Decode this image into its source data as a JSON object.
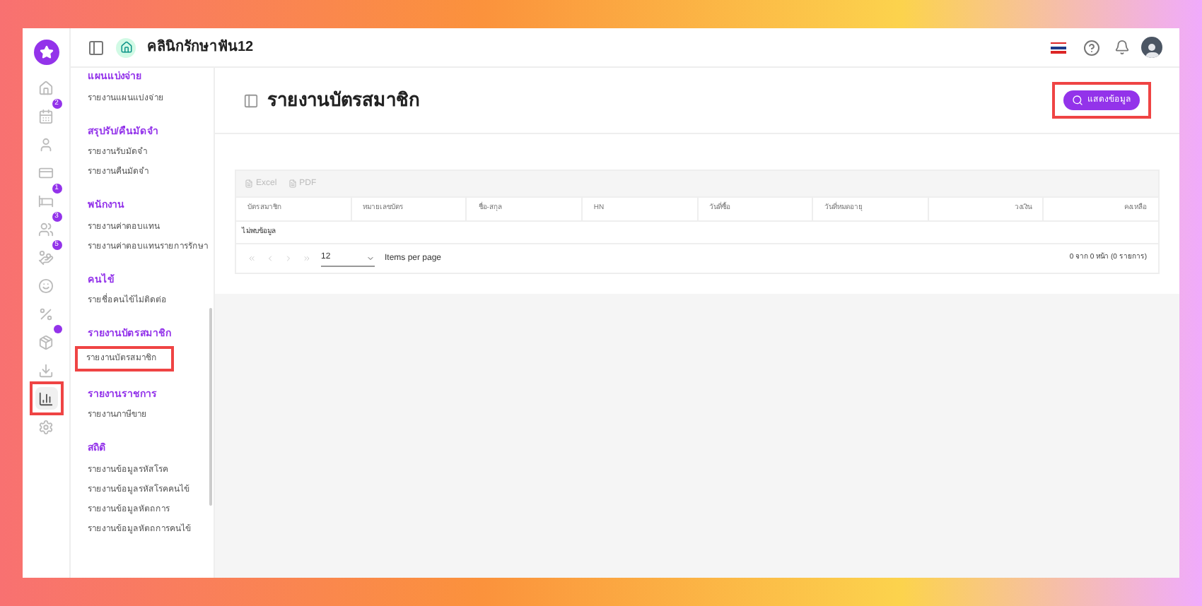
{
  "header": {
    "clinic_name": "คลินิกรักษาฟัน12"
  },
  "rail": [
    {
      "kind": "home",
      "selected": false
    },
    {
      "kind": "calendar",
      "selected": false,
      "badge": "2"
    },
    {
      "kind": "user",
      "selected": false
    },
    {
      "kind": "card",
      "selected": false
    },
    {
      "kind": "bed",
      "selected": false,
      "badge": "1"
    },
    {
      "kind": "people",
      "selected": false,
      "badge": "3"
    },
    {
      "kind": "hand",
      "selected": false,
      "badge": "5"
    },
    {
      "kind": "tooth",
      "selected": false
    },
    {
      "kind": "percent",
      "selected": false
    },
    {
      "kind": "box",
      "selected": false,
      "dot": true
    },
    {
      "kind": "download",
      "selected": false
    },
    {
      "kind": "chart",
      "selected": true
    },
    {
      "kind": "settings",
      "selected": false
    }
  ],
  "menu": [
    {
      "title": "แผนแบ่งจ่าย",
      "items": [
        {
          "label": "รายงานแผนแบ่งจ่าย",
          "selected": false
        }
      ]
    },
    {
      "title": "สรุปรับ/คืนมัดจำ",
      "items": [
        {
          "label": "รายงานรับมัดจำ",
          "selected": false
        },
        {
          "label": "รายงานคืนมัดจำ",
          "selected": false
        }
      ]
    },
    {
      "title": "พนักงาน",
      "items": [
        {
          "label": "รายงานค่าตอบแทน",
          "selected": false
        },
        {
          "label": "รายงานค่าตอบแทนรายการรักษา",
          "selected": false
        }
      ]
    },
    {
      "title": "คนไข้",
      "items": [
        {
          "label": "รายชื่อคนไข้ไม่ติดต่อ",
          "selected": false
        }
      ]
    },
    {
      "title": "รายงานบัตรสมาชิก",
      "items": [
        {
          "label": "รายงานบัตรสมาชิก",
          "selected": true
        }
      ]
    },
    {
      "title": "รายงานราชการ",
      "items": [
        {
          "label": "รายงานภาษีขาย",
          "selected": false
        }
      ]
    },
    {
      "title": "สถิติ",
      "items": [
        {
          "label": "รายงานข้อมูลรหัสโรค",
          "selected": false
        },
        {
          "label": "รายงานข้อมูลรหัสโรคคนไข้",
          "selected": false
        },
        {
          "label": "รายงานข้อมูลหัตถการ",
          "selected": false
        },
        {
          "label": "รายงานข้อมูลหัตถการคนไข้",
          "selected": false
        }
      ]
    }
  ],
  "page": {
    "title": "รายงานบัตรสมาชิก",
    "show_button": "แสดงข้อมูล"
  },
  "export": [
    "Excel",
    "PDF"
  ],
  "table": {
    "columns": [
      {
        "label": "บัตรสมาชิก",
        "kind": "text"
      },
      {
        "label": "หมายเลขบัตร",
        "kind": "text"
      },
      {
        "label": "ชื่อ-สกุล",
        "kind": "text"
      },
      {
        "label": "HN",
        "kind": "text"
      },
      {
        "label": "วันที่ซื้อ",
        "kind": "text"
      },
      {
        "label": "วันที่หมดอายุ",
        "kind": "text"
      },
      {
        "label": "วงเงิน",
        "kind": "number"
      },
      {
        "label": "คงเหลือ",
        "kind": "number"
      }
    ],
    "empty": "ไม่พบข้อมูล"
  },
  "pager": {
    "page_size": "12",
    "page_size_label": "Items per page",
    "summary": "0 จาก 0 หน้า (0 รายการ)"
  }
}
